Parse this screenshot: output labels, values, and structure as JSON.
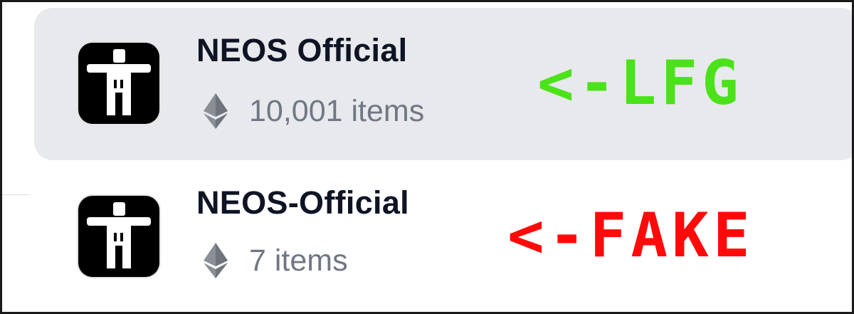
{
  "collections": [
    {
      "name": "NEOS Official",
      "count": "10,001 items",
      "annotation": "<-LFG",
      "selected": true
    },
    {
      "name": "NEOS-Official",
      "count": "7 items",
      "annotation": "<-FAKE",
      "selected": false
    }
  ],
  "colors": {
    "lfg": "#4be21a",
    "fake": "#ff0a0a",
    "selected_bg": "#e8e9ec"
  }
}
